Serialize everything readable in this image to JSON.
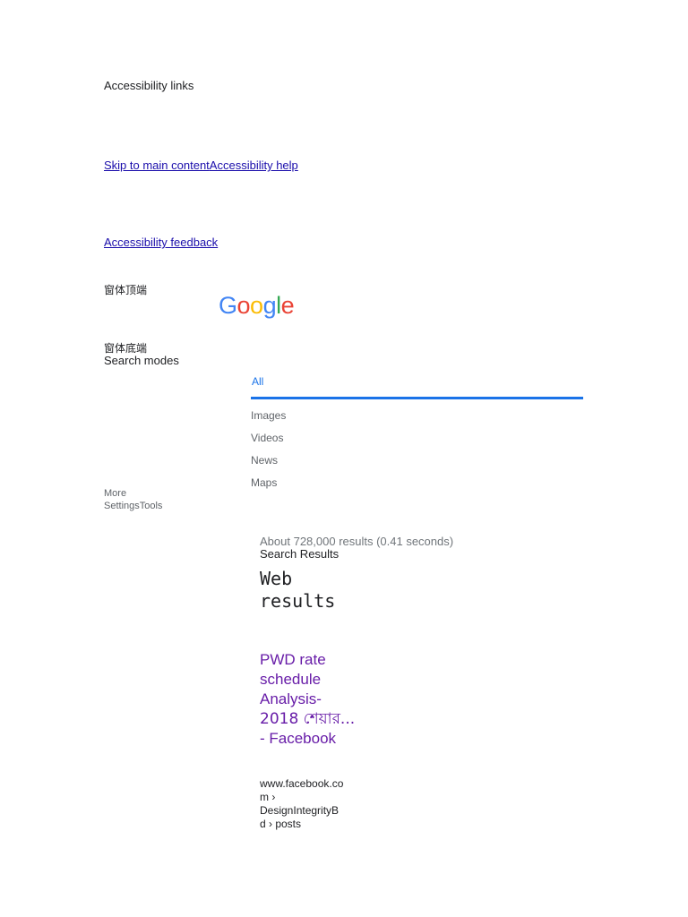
{
  "accessibility": {
    "heading": "Accessibility links",
    "skip_link": "Skip to main content",
    "help_link": "Accessibility help",
    "feedback_link": "Accessibility feedback"
  },
  "frame": {
    "top_label": "窗体顶端",
    "bottom_label": "窗体底端"
  },
  "logo": {
    "letters": [
      "G",
      "o",
      "o",
      "g",
      "l",
      "e"
    ],
    "colors": [
      "#4285f4",
      "#ea4335",
      "#fbbc05",
      "#4285f4",
      "#34a853",
      "#ea4335"
    ]
  },
  "search_modes": {
    "heading": "Search modes",
    "tabs": [
      {
        "label": "All",
        "active": true
      },
      {
        "label": "Images",
        "active": false
      },
      {
        "label": "Videos",
        "active": false
      },
      {
        "label": "News",
        "active": false
      },
      {
        "label": "Maps",
        "active": false
      }
    ],
    "more": "More",
    "settings": "Settings",
    "tools": "Tools",
    "accent_color": "#1a73e8"
  },
  "results": {
    "stats": "About 728,000 results (0.41 seconds)",
    "heading": "Search Results",
    "web_heading_line1": "Web",
    "web_heading_line2": "results",
    "items": [
      {
        "title_lines": [
          "PWD rate",
          "schedule",
          "Analysis-",
          "2018 শেয়ার...",
          "- Facebook"
        ],
        "url_lines": [
          "www.facebook.co",
          "m ›",
          "DesignIntegrityB",
          "d › posts"
        ],
        "title_color": "#681da8"
      }
    ]
  }
}
